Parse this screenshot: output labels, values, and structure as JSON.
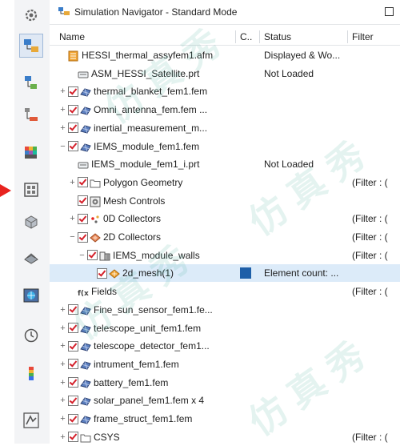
{
  "window": {
    "title": "Simulation Navigator - Standard Mode"
  },
  "columns": {
    "name": "Name",
    "c": "C..",
    "status": "Status",
    "filter": "Filter"
  },
  "rows": [
    {
      "id": "afm",
      "indent": 0,
      "exp": "",
      "chk": false,
      "icon": "assembly-fem-icon",
      "label": "HESSI_thermal_assyfem1.afm",
      "status": "Displayed & Wo...",
      "filter": "",
      "sel": false
    },
    {
      "id": "asm-prt",
      "indent": 1,
      "exp": "",
      "chk": false,
      "icon": "part-file-icon",
      "label": "ASM_HESSI_Satellite.prt",
      "status": "Not Loaded",
      "filter": "",
      "sel": false
    },
    {
      "id": "thermal-blanket",
      "indent": 0,
      "exp": "+",
      "chk": true,
      "icon": "fem-icon",
      "label": "thermal_blanket_fem1.fem",
      "status": "",
      "filter": "",
      "sel": false
    },
    {
      "id": "omni-antenna",
      "indent": 0,
      "exp": "+",
      "chk": true,
      "icon": "fem-icon",
      "label": "Omni_antenna_fem.fem ...",
      "status": "",
      "filter": "",
      "sel": false
    },
    {
      "id": "inertial",
      "indent": 0,
      "exp": "+",
      "chk": true,
      "icon": "fem-icon",
      "label": "inertial_measurement_m...",
      "status": "",
      "filter": "",
      "sel": false
    },
    {
      "id": "iems-module",
      "indent": 0,
      "exp": "−",
      "chk": true,
      "icon": "fem-icon",
      "label": "IEMS_module_fem1.fem",
      "status": "",
      "filter": "",
      "sel": false
    },
    {
      "id": "iems-prt",
      "indent": 1,
      "exp": "",
      "chk": false,
      "icon": "part-file-icon",
      "label": "IEMS_module_fem1_i.prt",
      "status": "Not Loaded",
      "filter": "",
      "sel": false
    },
    {
      "id": "polygon-geometry",
      "indent": 1,
      "exp": "+",
      "chk": true,
      "icon": "folder-icon",
      "label": "Polygon Geometry",
      "status": "",
      "filter": "(Filter : (",
      "sel": false
    },
    {
      "id": "mesh-controls",
      "indent": 1,
      "exp": "",
      "chk": true,
      "icon": "mesh-controls-icon",
      "label": "Mesh Controls",
      "status": "",
      "filter": "",
      "sel": false
    },
    {
      "id": "0d-collectors",
      "indent": 1,
      "exp": "+",
      "chk": true,
      "icon": "0d-collector-icon",
      "label": "0D Collectors",
      "status": "",
      "filter": "(Filter : (",
      "sel": false
    },
    {
      "id": "2d-collectors",
      "indent": 1,
      "exp": "−",
      "chk": true,
      "icon": "2d-collector-icon",
      "label": "2D Collectors",
      "status": "",
      "filter": "(Filter : (",
      "sel": false
    },
    {
      "id": "iems-walls",
      "indent": 2,
      "exp": "−",
      "chk": true,
      "icon": "mesh-collector-icon",
      "label": "IEMS_module_walls",
      "status": "",
      "filter": "(Filter : (",
      "sel": false
    },
    {
      "id": "2d-mesh",
      "indent": 3,
      "exp": "",
      "chk": true,
      "icon": "2d-mesh-icon",
      "label": "2d_mesh(1)",
      "status": "Element count: ...",
      "filter": "",
      "sel": true,
      "swatch": "#1e5fa8"
    },
    {
      "id": "fields",
      "indent": 1,
      "exp": "",
      "chk": false,
      "icon": "fields-icon",
      "label": "Fields",
      "status": "",
      "filter": "(Filter : (",
      "sel": false
    },
    {
      "id": "fine-sun-sensor",
      "indent": 0,
      "exp": "+",
      "chk": true,
      "icon": "fem-icon",
      "label": "Fine_sun_sensor_fem1.fe...",
      "status": "",
      "filter": "",
      "sel": false
    },
    {
      "id": "telescope-unit",
      "indent": 0,
      "exp": "+",
      "chk": true,
      "icon": "fem-icon",
      "label": "telescope_unit_fem1.fem",
      "status": "",
      "filter": "",
      "sel": false
    },
    {
      "id": "telescope-detector",
      "indent": 0,
      "exp": "+",
      "chk": true,
      "icon": "fem-icon",
      "label": "telescope_detector_fem1...",
      "status": "",
      "filter": "",
      "sel": false
    },
    {
      "id": "intrument",
      "indent": 0,
      "exp": "+",
      "chk": true,
      "icon": "fem-icon",
      "label": "intrument_fem1.fem",
      "status": "",
      "filter": "",
      "sel": false
    },
    {
      "id": "battery",
      "indent": 0,
      "exp": "+",
      "chk": true,
      "icon": "fem-icon",
      "label": "battery_fem1.fem",
      "status": "",
      "filter": "",
      "sel": false
    },
    {
      "id": "solar-panel",
      "indent": 0,
      "exp": "+",
      "chk": true,
      "icon": "fem-icon",
      "label": "solar_panel_fem1.fem x 4",
      "status": "",
      "filter": "",
      "sel": false
    },
    {
      "id": "frame-struct",
      "indent": 0,
      "exp": "+",
      "chk": true,
      "icon": "fem-icon",
      "label": "frame_struct_fem1.fem",
      "status": "",
      "filter": "",
      "sel": false
    },
    {
      "id": "csys",
      "indent": 0,
      "exp": "+",
      "chk": true,
      "icon": "folder-icon",
      "label": "CSYS",
      "status": "",
      "filter": "(Filter : (",
      "sel": false
    }
  ],
  "tools": [
    {
      "icon": "gear-icon",
      "selected": false
    },
    {
      "icon": "simulation-navigator-icon",
      "selected": true
    },
    {
      "icon": "simulation-file-view-icon",
      "selected": false
    },
    {
      "icon": "assembly-navigator-icon",
      "selected": false
    },
    {
      "icon": "color-palette-icon",
      "selected": false
    },
    {
      "icon": "layout-grid-icon",
      "selected": false
    },
    {
      "icon": "part-3d-icon",
      "selected": false
    },
    {
      "icon": "reuse-library-icon",
      "selected": false
    },
    {
      "icon": "web-browser-icon",
      "selected": false
    },
    {
      "icon": "history-clock-icon",
      "selected": false
    },
    {
      "icon": "post-processing-icon",
      "selected": false
    },
    {
      "icon": "process-studio-icon",
      "selected": false
    }
  ]
}
